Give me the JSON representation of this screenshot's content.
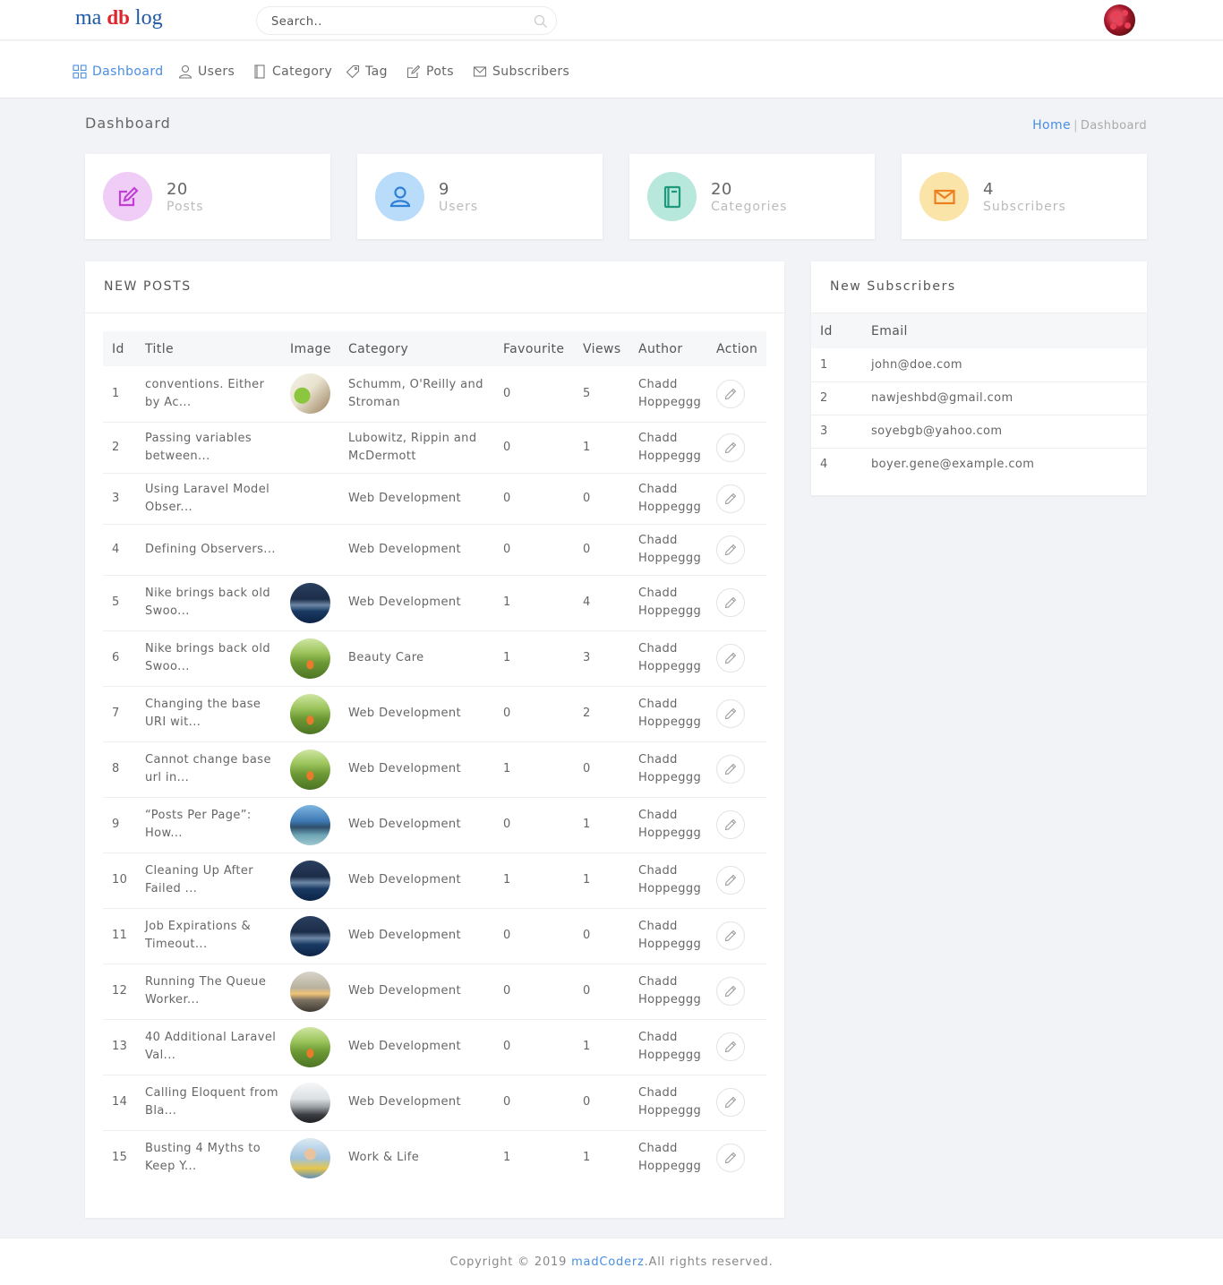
{
  "logo": {
    "part1": "ma",
    "part2": "db",
    "part3": "log"
  },
  "search": {
    "placeholder": "Search.."
  },
  "nav": [
    {
      "label": "Dashboard",
      "icon": "grid-icon"
    },
    {
      "label": "Users",
      "icon": "user-icon"
    },
    {
      "label": "Category",
      "icon": "book-icon"
    },
    {
      "label": "Tag",
      "icon": "tag-icon"
    },
    {
      "label": "Pots",
      "icon": "edit-icon"
    },
    {
      "label": "Subscribers",
      "icon": "mail-icon"
    }
  ],
  "page": {
    "title": "Dashboard"
  },
  "breadcrumb": {
    "home": "Home",
    "separator": "|",
    "current": "Dashboard"
  },
  "stats": [
    {
      "value": "20",
      "label": "Posts",
      "color": "#d478e6"
    },
    {
      "value": "9",
      "label": "Users",
      "color": "#3a8ee6"
    },
    {
      "value": "20",
      "label": "Categories",
      "color": "#23a588"
    },
    {
      "value": "4",
      "label": "Subscribers",
      "color": "#f0892a"
    }
  ],
  "new_posts": {
    "heading": "NEW POSTS",
    "columns": [
      "Id",
      "Title",
      "Image",
      "Category",
      "Favourite",
      "Views",
      "Author",
      "Action"
    ],
    "rows": [
      {
        "id": "1",
        "title": "conventions. Either by Ac...",
        "image": "infographic",
        "category": "Schumm, O'Reilly and Stroman",
        "favourite": "0",
        "views": "5",
        "author": "Chadd Hoppeggg"
      },
      {
        "id": "2",
        "title": "Passing variables between...",
        "image": "",
        "category": "Lubowitz, Rippin and McDermott",
        "favourite": "0",
        "views": "1",
        "author": "Chadd Hoppeggg"
      },
      {
        "id": "3",
        "title": "Using Laravel Model Obser...",
        "image": "",
        "category": "Web Development",
        "favourite": "0",
        "views": "0",
        "author": "Chadd Hoppeggg"
      },
      {
        "id": "4",
        "title": "Defining Observers...",
        "image": "",
        "category": "Web Development",
        "favourite": "0",
        "views": "0",
        "author": "Chadd Hoppeggg"
      },
      {
        "id": "5",
        "title": "Nike brings back old Swoo...",
        "image": "ocean",
        "category": "Web Development",
        "favourite": "1",
        "views": "4",
        "author": "Chadd Hoppeggg"
      },
      {
        "id": "6",
        "title": "Nike brings back old Swoo...",
        "image": "field",
        "category": "Beauty Care",
        "favourite": "1",
        "views": "3",
        "author": "Chadd Hoppeggg"
      },
      {
        "id": "7",
        "title": "Changing the base URI wit...",
        "image": "field",
        "category": "Web Development",
        "favourite": "0",
        "views": "2",
        "author": "Chadd Hoppeggg"
      },
      {
        "id": "8",
        "title": "Cannot change base url in...",
        "image": "field",
        "category": "Web Development",
        "favourite": "1",
        "views": "0",
        "author": "Chadd Hoppeggg"
      },
      {
        "id": "9",
        "title": "“Posts Per Page”: How...",
        "image": "lake",
        "category": "Web Development",
        "favourite": "0",
        "views": "1",
        "author": "Chadd Hoppeggg"
      },
      {
        "id": "10",
        "title": "Cleaning Up After Failed ...",
        "image": "ocean",
        "category": "Web Development",
        "favourite": "1",
        "views": "1",
        "author": "Chadd Hoppeggg"
      },
      {
        "id": "11",
        "title": "Job Expirations & Timeout...",
        "image": "ocean",
        "category": "Web Development",
        "favourite": "0",
        "views": "0",
        "author": "Chadd Hoppeggg"
      },
      {
        "id": "12",
        "title": "Running The Queue Worker...",
        "image": "sunset",
        "category": "Web Development",
        "favourite": "0",
        "views": "0",
        "author": "Chadd Hoppeggg"
      },
      {
        "id": "13",
        "title": "40 Additional Laravel Val...",
        "image": "field",
        "category": "Web Development",
        "favourite": "0",
        "views": "1",
        "author": "Chadd Hoppeggg"
      },
      {
        "id": "14",
        "title": "Calling Eloquent from Bla...",
        "image": "mist",
        "category": "Web Development",
        "favourite": "0",
        "views": "0",
        "author": "Chadd Hoppeggg"
      },
      {
        "id": "15",
        "title": "Busting 4 Myths to Keep Y...",
        "image": "portrait",
        "category": "Work & Life",
        "favourite": "1",
        "views": "1",
        "author": "Chadd Hoppeggg"
      }
    ]
  },
  "new_subscribers": {
    "heading": "New Subscribers",
    "columns": [
      "Id",
      "Email"
    ],
    "rows": [
      {
        "id": "1",
        "email": "john@doe.com"
      },
      {
        "id": "2",
        "email": "nawjeshbd@gmail.com"
      },
      {
        "id": "3",
        "email": "soyebgb@yahoo.com"
      },
      {
        "id": "4",
        "email": "boyer.gene@example.com"
      }
    ]
  },
  "footer": {
    "prefix": "Copyright © 2019 ",
    "brand": "madCoderz",
    "suffix": ".All rights reserved."
  }
}
